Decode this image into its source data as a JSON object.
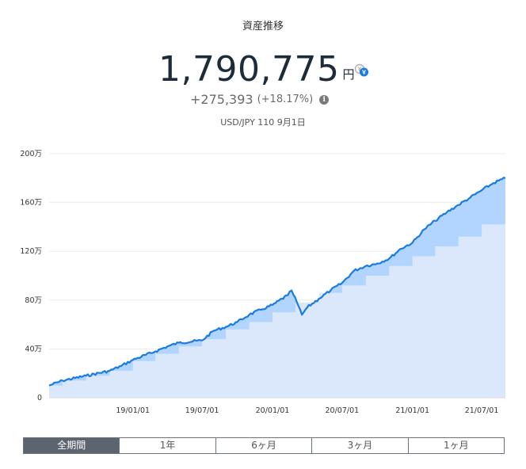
{
  "header": {
    "title": "資産推移",
    "total_amount": "1,790,775",
    "currency_unit": "円",
    "change_amount": "+275,393",
    "change_percent": "(+18.17%)",
    "rate_note": "USD/JPY 110 9月1日",
    "swap_icon": "currency-swap-icon",
    "info_icon": "info-icon"
  },
  "colors": {
    "asset_line": "#1a7be0",
    "gain_area": "#a8d0ff",
    "principal_area": "#dbe8fb",
    "active_tab": "#5c6470"
  },
  "chart_data": {
    "type": "area",
    "yticks": [
      0,
      40,
      80,
      120,
      160,
      200
    ],
    "ytick_labels": [
      "0",
      "40万",
      "80万",
      "120万",
      "160万",
      "200万"
    ],
    "ylim": [
      0,
      200
    ],
    "xlim": [
      "2018-05-27",
      "2021-09-01"
    ],
    "xticks": [
      "2019-01-01",
      "2019-07-01",
      "2020-01-01",
      "2020-07-01",
      "2021-01-01",
      "2021-07-01"
    ],
    "xtick_labels": [
      "19/01/01",
      "19/07/01",
      "20/01/01",
      "20/07/01",
      "21/01/01",
      "21/07/01"
    ],
    "grid": true,
    "series": [
      {
        "key": "asset",
        "x": [
          "2018-05-27",
          "2018-07-01",
          "2018-09-01",
          "2018-11-01",
          "2018-12-01",
          "2019-01-01",
          "2019-03-01",
          "2019-04-01",
          "2019-05-01",
          "2019-07-01",
          "2019-08-01",
          "2019-09-01",
          "2019-10-01",
          "2019-11-01",
          "2019-12-01",
          "2020-01-01",
          "2020-02-10",
          "2020-02-20",
          "2020-03-05",
          "2020-03-18",
          "2020-04-01",
          "2020-05-01",
          "2020-06-01",
          "2020-07-01",
          "2020-08-01",
          "2020-09-01",
          "2020-10-01",
          "2020-11-01",
          "2020-12-01",
          "2021-01-01",
          "2021-02-01",
          "2021-03-01",
          "2021-04-01",
          "2021-05-01",
          "2021-06-01",
          "2021-07-01",
          "2021-08-01",
          "2021-09-01"
        ],
        "y": [
          10,
          14,
          18,
          22,
          26,
          31,
          38,
          42,
          45,
          47,
          55,
          58,
          62,
          68,
          72,
          76,
          84,
          88,
          78,
          68,
          74,
          81,
          88,
          94,
          104,
          108,
          110,
          114,
          122,
          127,
          138,
          145,
          152,
          158,
          164,
          170,
          176,
          180
        ]
      },
      {
        "key": "principal",
        "x": [
          "2018-05-27",
          "2018-07-01",
          "2018-09-01",
          "2018-11-01",
          "2019-01-01",
          "2019-03-01",
          "2019-05-01",
          "2019-07-01",
          "2019-09-01",
          "2019-11-01",
          "2020-01-01",
          "2020-03-01",
          "2020-05-01",
          "2020-07-01",
          "2020-09-01",
          "2020-11-01",
          "2021-01-01",
          "2021-03-01",
          "2021-05-01",
          "2021-07-01",
          "2021-09-01"
        ],
        "y": [
          10,
          14,
          18,
          22,
          30,
          36,
          42,
          48,
          56,
          62,
          70,
          78,
          86,
          92,
          100,
          108,
          116,
          124,
          132,
          142,
          153
        ]
      }
    ]
  },
  "tabs": [
    {
      "label": "全期間",
      "active": true
    },
    {
      "label": "1年",
      "active": false
    },
    {
      "label": "6ヶ月",
      "active": false
    },
    {
      "label": "3ヶ月",
      "active": false
    },
    {
      "label": "1ヶ月",
      "active": false
    }
  ]
}
